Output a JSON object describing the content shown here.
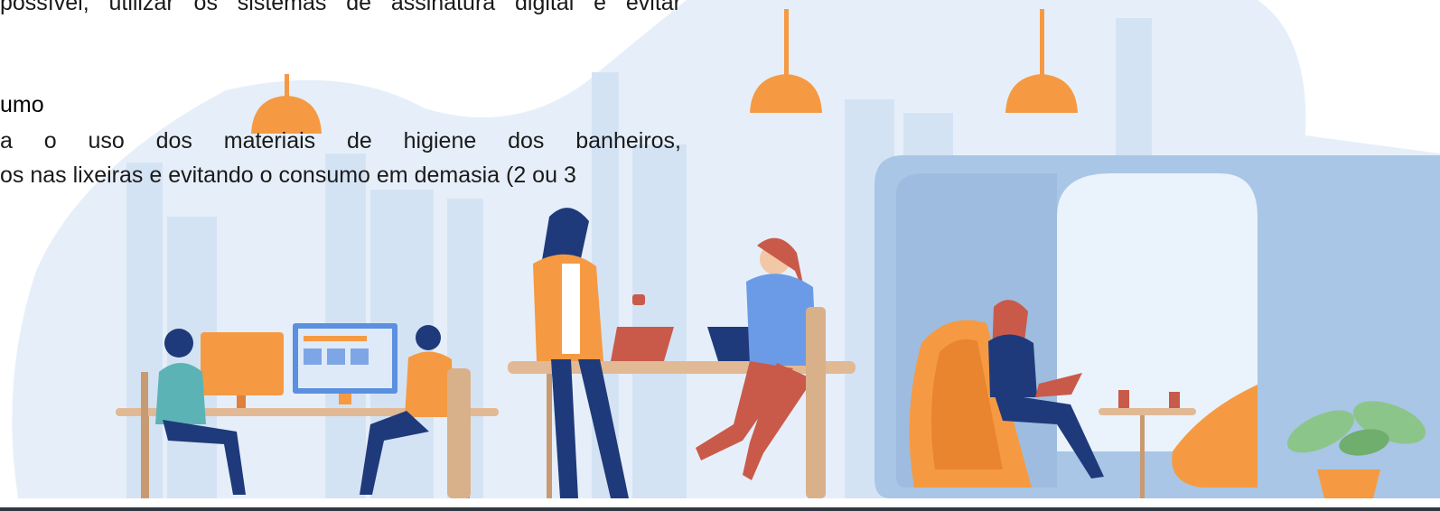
{
  "document": {
    "line_1": "possível, utilizar os sistemas de assinatura digital e evitar",
    "heading": "umo",
    "line_2": "a o uso dos materiais de higiene dos banheiros,",
    "line_3": "os nas lixeiras e evitando o consumo em demasia (2 ou 3"
  },
  "illustration": {
    "subject": "coworking-office-scene",
    "colors": {
      "background_blob": "#e3edf8",
      "skyline": "#d2e2f3",
      "pod": "#a9c6e6",
      "orange": "#f59a42",
      "navy": "#1f3a7a",
      "table_wood": "#e2b995",
      "plant_green": "#8cc58a"
    }
  }
}
